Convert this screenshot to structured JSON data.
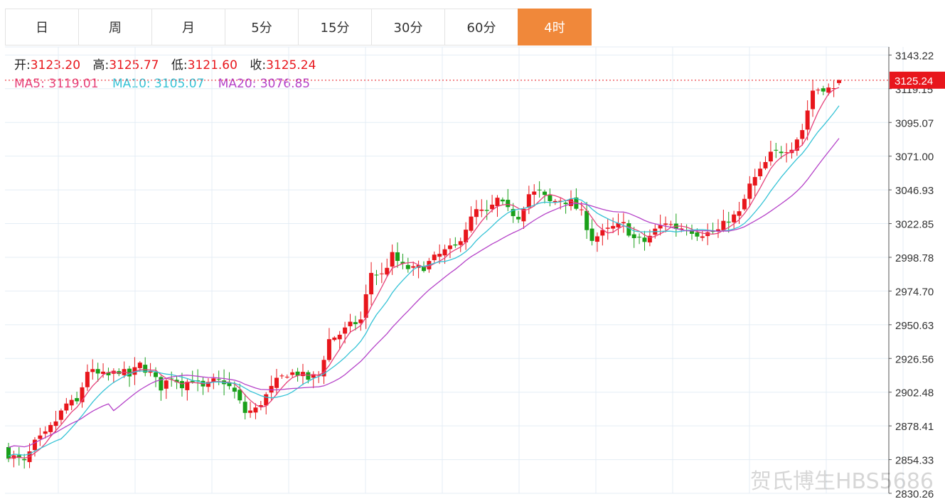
{
  "tabs": [
    {
      "label": "日",
      "active": false
    },
    {
      "label": "周",
      "active": false
    },
    {
      "label": "月",
      "active": false
    },
    {
      "label": "5分",
      "active": false
    },
    {
      "label": "15分",
      "active": false
    },
    {
      "label": "30分",
      "active": false
    },
    {
      "label": "60分",
      "active": false
    },
    {
      "label": "4时",
      "active": true
    }
  ],
  "ohlc_info": {
    "open_label": "开:",
    "open": "3123.20",
    "high_label": "高:",
    "high": "3125.77",
    "low_label": "低:",
    "low": "3121.60",
    "close_label": "收:",
    "close": "3125.24"
  },
  "ma_info": {
    "ma5_label": "MA5:",
    "ma5": "3119.01",
    "ma10_label": "MA10:",
    "ma10": "3105.07",
    "ma20_label": "MA20:",
    "ma20": "3076.85"
  },
  "watermark": "贺氏博生HBS5686",
  "colors": {
    "up": "#e8161c",
    "down": "#1aa01a",
    "ma5": "#e6417a",
    "ma10": "#35c3d6",
    "ma20": "#b542c8",
    "grid": "#e4edf5",
    "active_tab": "#f0883a"
  },
  "chart_data": {
    "type": "candlestick",
    "ylim": [
      2830.26,
      3149.0
    ],
    "y_ticks": [
      "3143.22",
      "3119.15",
      "3095.07",
      "3071.00",
      "3046.93",
      "3022.85",
      "2998.78",
      "2974.70",
      "2950.63",
      "2926.56",
      "2902.48",
      "2878.41",
      "2854.33",
      "2830.26"
    ],
    "last_price": "3125.24",
    "x_grid_count": 12,
    "anchors": [
      [
        0,
        2858
      ],
      [
        3,
        2852
      ],
      [
        5,
        2866
      ],
      [
        7,
        2872
      ],
      [
        9,
        2882
      ],
      [
        11,
        2894
      ],
      [
        13,
        2895
      ],
      [
        15,
        2918
      ],
      [
        17,
        2915
      ],
      [
        19,
        2914
      ],
      [
        21,
        2918
      ],
      [
        23,
        2914
      ],
      [
        25,
        2922
      ],
      [
        27,
        2916
      ],
      [
        29,
        2906
      ],
      [
        31,
        2914
      ],
      [
        33,
        2908
      ],
      [
        35,
        2912
      ],
      [
        37,
        2905
      ],
      [
        39,
        2910
      ],
      [
        41,
        2910
      ],
      [
        43,
        2902
      ],
      [
        45,
        2888
      ],
      [
        47,
        2890
      ],
      [
        49,
        2900
      ],
      [
        51,
        2910
      ],
      [
        53,
        2916
      ],
      [
        55,
        2916
      ],
      [
        57,
        2912
      ],
      [
        59,
        2915
      ],
      [
        61,
        2940
      ],
      [
        63,
        2944
      ],
      [
        65,
        2950
      ],
      [
        67,
        2954
      ],
      [
        69,
        2988
      ],
      [
        71,
        2986
      ],
      [
        73,
        3000
      ],
      [
        75,
        2992
      ],
      [
        77,
        2990
      ],
      [
        79,
        2992
      ],
      [
        81,
        2998
      ],
      [
        83,
        3003
      ],
      [
        85,
        3006
      ],
      [
        87,
        3020
      ],
      [
        89,
        3032
      ],
      [
        91,
        3030
      ],
      [
        93,
        3040
      ],
      [
        95,
        3032
      ],
      [
        97,
        3028
      ],
      [
        99,
        3044
      ],
      [
        101,
        3045
      ],
      [
        103,
        3038
      ],
      [
        105,
        3040
      ],
      [
        107,
        3038
      ],
      [
        109,
        3030
      ],
      [
        111,
        3012
      ],
      [
        113,
        3016
      ],
      [
        115,
        3020
      ],
      [
        117,
        3022
      ],
      [
        119,
        3012
      ],
      [
        121,
        3010
      ],
      [
        123,
        3018
      ],
      [
        125,
        3024
      ],
      [
        127,
        3020
      ],
      [
        129,
        3020
      ],
      [
        131,
        3016
      ],
      [
        133,
        3016
      ],
      [
        135,
        3018
      ],
      [
        137,
        3026
      ],
      [
        139,
        3030
      ],
      [
        141,
        3050
      ],
      [
        143,
        3060
      ],
      [
        145,
        3072
      ],
      [
        147,
        3075
      ],
      [
        149,
        3078
      ],
      [
        151,
        3090
      ],
      [
        153,
        3118
      ],
      [
        155,
        3120
      ],
      [
        157,
        3118
      ],
      [
        158,
        3125.24
      ]
    ],
    "ma5_label": "MA5",
    "ma10_label": "MA10",
    "ma20_label": "MA20"
  }
}
